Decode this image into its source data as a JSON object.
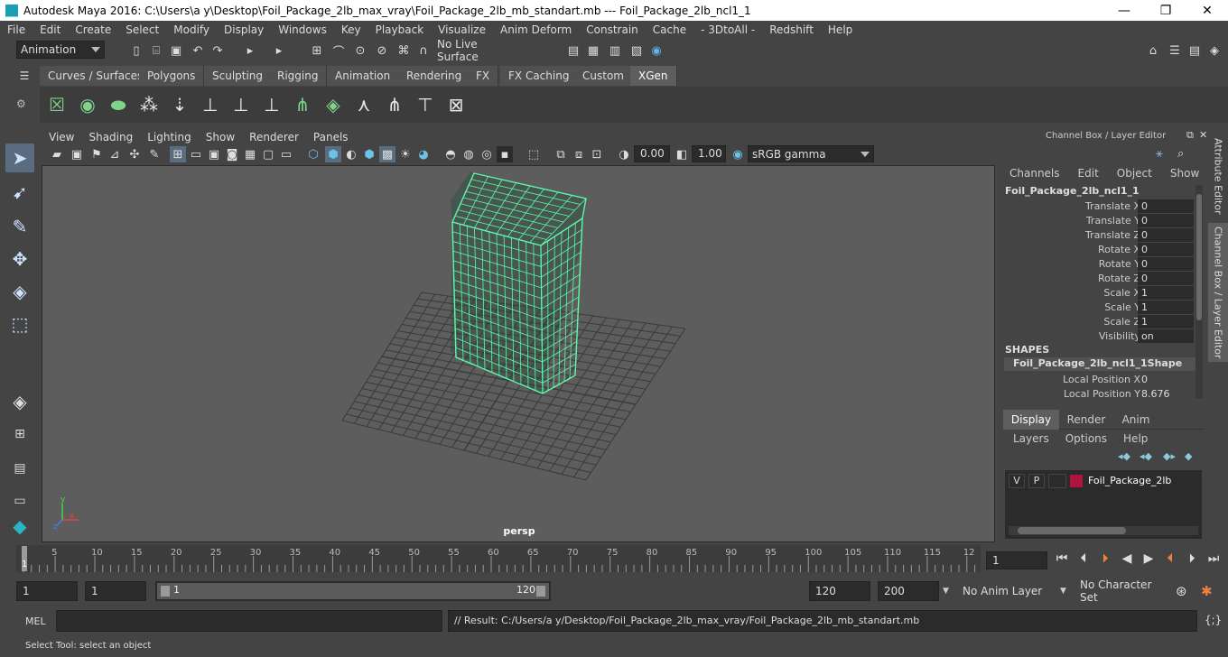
{
  "window": {
    "title": "Autodesk Maya 2016: C:\\Users\\a y\\Desktop\\Foil_Package_2lb_max_vray\\Foil_Package_2lb_mb_standart.mb   ---   Foil_Package_2lb_ncl1_1",
    "minimize": "—",
    "maximize": "❐",
    "close": "✕"
  },
  "menu": [
    "File",
    "Edit",
    "Create",
    "Select",
    "Modify",
    "Display",
    "Windows",
    "Key",
    "Playback",
    "Visualize",
    "Anim Deform",
    "Constrain",
    "Cache",
    "- 3DtoAll -",
    "Redshift",
    "Help"
  ],
  "statusline": {
    "mode": "Animation",
    "live_surface": "No Live Surface"
  },
  "shelf_tabs": [
    {
      "label": "Curves / Surfaces",
      "active": false
    },
    {
      "label": "Polygons",
      "active": false
    },
    {
      "label": "Sculpting",
      "active": false
    },
    {
      "label": "Rigging",
      "active": false
    },
    {
      "label": "Animation",
      "active": false
    },
    {
      "label": "Rendering",
      "active": false
    },
    {
      "label": "FX",
      "active": false
    },
    {
      "label": "FX Caching",
      "active": false
    },
    {
      "label": "Custom",
      "active": false
    },
    {
      "label": "XGen",
      "active": true
    }
  ],
  "viewport": {
    "menu": [
      "View",
      "Shading",
      "Lighting",
      "Show",
      "Renderer",
      "Panels"
    ],
    "exposure": "0.00",
    "gamma": "1.00",
    "colorspace": "sRGB gamma",
    "camera_label": "persp",
    "wire_color": "#5dfaa8",
    "grid_color": "#3a3a3a"
  },
  "channelbox": {
    "header": "Channel Box / Layer Editor",
    "menu": [
      "Channels",
      "Edit",
      "Object",
      "Show"
    ],
    "object_name": "Foil_Package_2lb_ncl1_1",
    "attributes": [
      {
        "label": "Translate X",
        "value": "0"
      },
      {
        "label": "Translate Y",
        "value": "0"
      },
      {
        "label": "Translate Z",
        "value": "0"
      },
      {
        "label": "Rotate X",
        "value": "0"
      },
      {
        "label": "Rotate Y",
        "value": "0"
      },
      {
        "label": "Rotate Z",
        "value": "0"
      },
      {
        "label": "Scale X",
        "value": "1"
      },
      {
        "label": "Scale Y",
        "value": "1"
      },
      {
        "label": "Scale Z",
        "value": "1"
      },
      {
        "label": "Visibility",
        "value": "on"
      }
    ],
    "shapes_header": "SHAPES",
    "shape_name": "Foil_Package_2lb_ncl1_1Shape",
    "shape_attributes": [
      {
        "label": "Local Position X",
        "value": "0"
      },
      {
        "label": "Local Position Y",
        "value": "8.676"
      }
    ]
  },
  "layer_editor": {
    "tabs": [
      "Display",
      "Render",
      "Anim"
    ],
    "active_tab": "Display",
    "menu": [
      "Layers",
      "Options",
      "Help"
    ],
    "layer": {
      "v": "V",
      "p": "P",
      "name": "Foil_Package_2lb",
      "color": "#b0143c"
    }
  },
  "side_tabs": [
    "Attribute Editor",
    "Channel Box / Layer Editor"
  ],
  "timeline": {
    "ticks": [
      "5",
      "10",
      "15",
      "20",
      "25",
      "30",
      "35",
      "40",
      "45",
      "50",
      "55",
      "60",
      "65",
      "70",
      "75",
      "80",
      "85",
      "90",
      "95",
      "100",
      "105",
      "110",
      "115",
      "12"
    ],
    "current_frame": "1",
    "frame_marker": "1"
  },
  "range": {
    "start": "1",
    "current": "1",
    "slider_start": "1",
    "slider_end": "120",
    "end": "120",
    "max": "200",
    "anim_layer": "No Anim Layer",
    "char_set": "No Character Set"
  },
  "cmdline": {
    "lang": "MEL",
    "result": "// Result: C:/Users/a y/Desktop/Foil_Package_2lb_max_vray/Foil_Package_2lb_mb_standart.mb"
  },
  "help": "Select Tool: select an object"
}
